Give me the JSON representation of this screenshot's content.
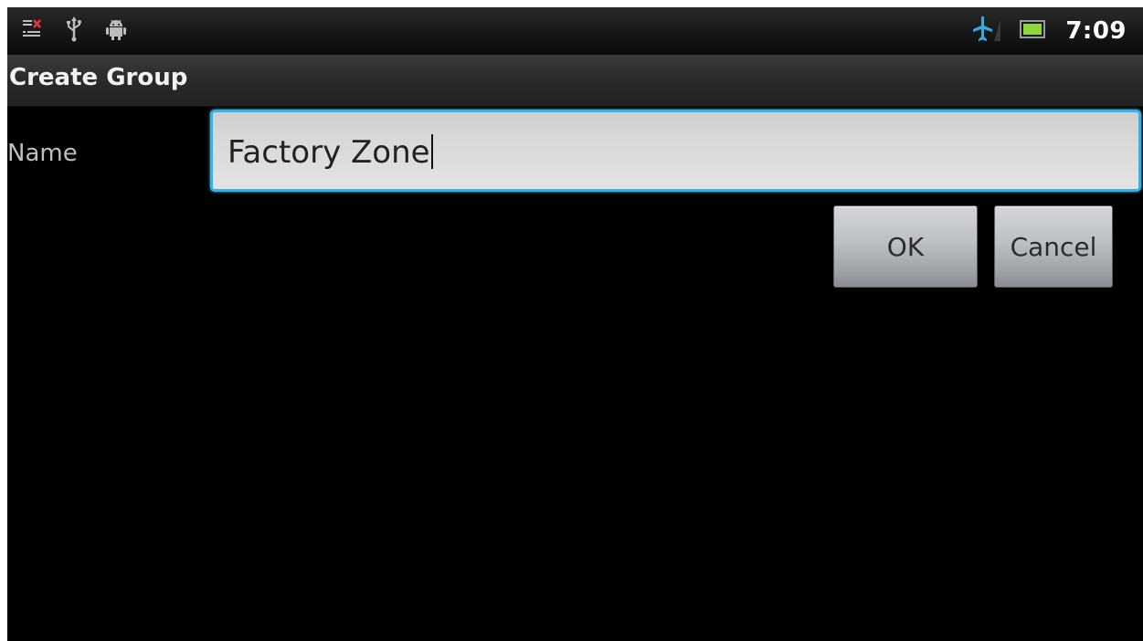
{
  "status_bar": {
    "time": "7:09",
    "left_icons": [
      "notification-icon",
      "usb-icon",
      "android-debug-icon"
    ],
    "right_icons": [
      "airplane-mode-icon",
      "battery-icon"
    ],
    "accent_color": "#36b0e8"
  },
  "title_bar": {
    "title": "Create Group"
  },
  "form": {
    "name_label": "Name",
    "name_value": "Factory Zone"
  },
  "buttons": {
    "ok_label": "OK",
    "cancel_label": "Cancel"
  }
}
